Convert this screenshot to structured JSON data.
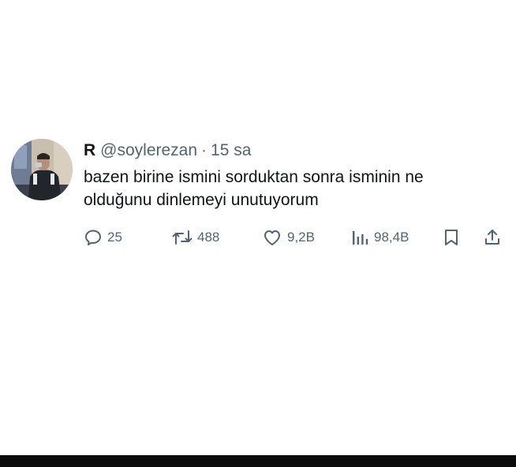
{
  "tweet": {
    "display_name": "R",
    "handle": "@soylerezan",
    "separator": "·",
    "time": "15 sa",
    "text": "bazen birine ismini sorduktan sonra isminin ne olduğunu dinlemeyi unutuyorum",
    "actions": {
      "replies": "25",
      "retweets": "488",
      "likes": "9,2B",
      "views": "98,4B"
    },
    "icons": {
      "reply": "reply-icon",
      "retweet": "retweet-icon",
      "like": "like-icon",
      "views": "views-icon",
      "bookmark": "bookmark-icon",
      "share": "share-icon"
    }
  },
  "colors": {
    "text": "#0f1419",
    "secondary": "#536471",
    "background": "#ffffff",
    "bottom_bar": "#0b0b0b"
  }
}
